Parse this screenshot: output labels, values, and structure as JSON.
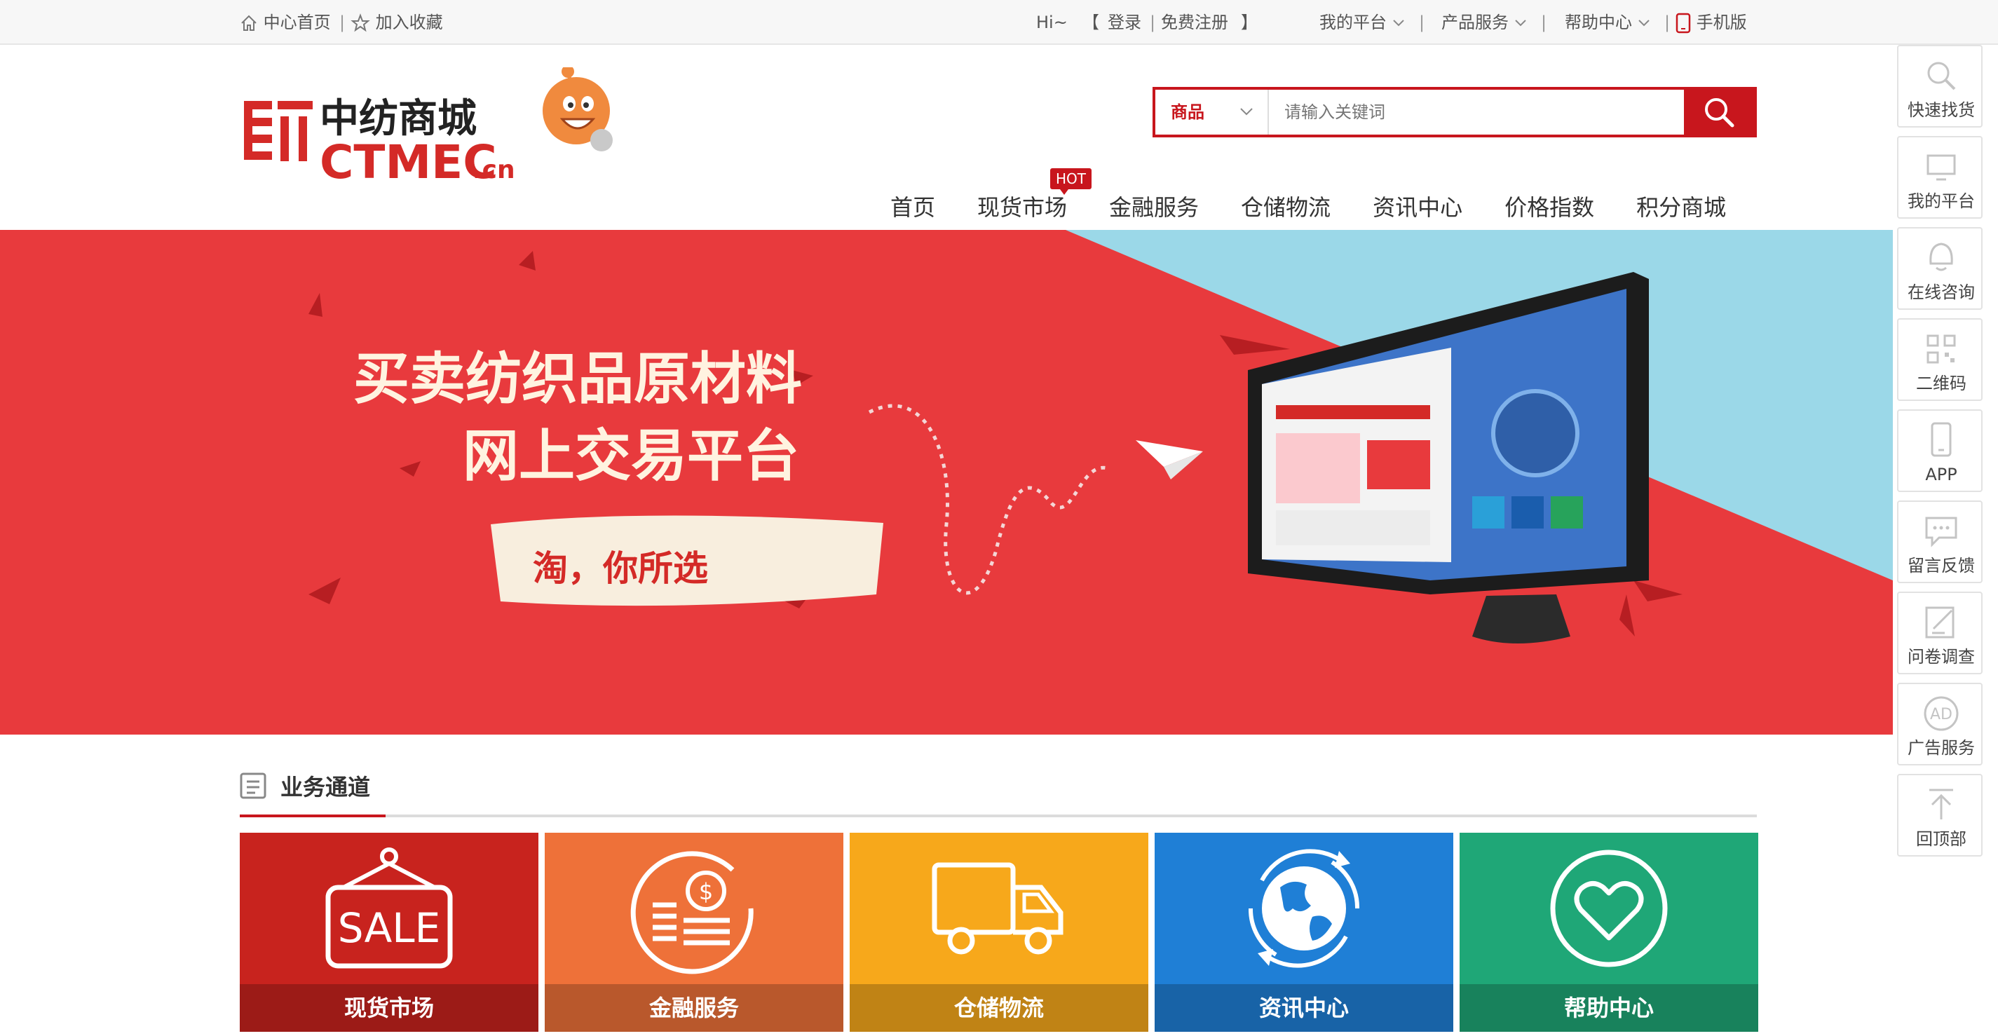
{
  "topbar": {
    "home_link": "中心首页",
    "favorite_link": "加入收藏",
    "greeting": "Hi~",
    "bracket_open": "【",
    "login": "登录",
    "register": "免费注册",
    "bracket_close": "】",
    "my_platform": "我的平台",
    "product_service": "产品服务",
    "help_center": "帮助中心",
    "mobile": "手机版"
  },
  "logo": {
    "name_cn": "中纺商城",
    "name_en": "CTMEC",
    "domain_suffix": ".cn"
  },
  "search": {
    "category": "商品",
    "placeholder": "请输入关键词",
    "value": ""
  },
  "nav": {
    "items": [
      "首页",
      "现货市场",
      "金融服务",
      "仓储物流",
      "资讯中心",
      "价格指数",
      "积分商城"
    ],
    "hot_badge": "HOT"
  },
  "banner": {
    "line1": "买卖纺织品原材料",
    "line2": "网上交易平台",
    "slogan": "淘，你所选",
    "slides": 2,
    "active_slide": 2,
    "colors": {
      "red": "#e83a3d",
      "blue": "#9bd8e8"
    }
  },
  "section": {
    "title": "业务通道"
  },
  "tiles": [
    {
      "label": "现货市场",
      "color": "#c8231e",
      "icon": "sale-sign-icon",
      "icon_text": "SALE"
    },
    {
      "label": "金融服务",
      "color": "#ee7139",
      "icon": "coins-icon",
      "icon_text": "$"
    },
    {
      "label": "仓储物流",
      "color": "#f7a81b",
      "icon": "truck-icon"
    },
    {
      "label": "资讯中心",
      "color": "#1f7fd6",
      "icon": "globe-icon"
    },
    {
      "label": "帮助中心",
      "color": "#1fa777",
      "icon": "heart-icon"
    }
  ],
  "sidebar": [
    {
      "label": "快速找货",
      "icon": "search-icon"
    },
    {
      "label": "我的平台",
      "icon": "monitor-icon"
    },
    {
      "label": "在线咨询",
      "icon": "chat-person-icon"
    },
    {
      "label": "二维码",
      "icon": "qr-code-icon"
    },
    {
      "label": "APP",
      "icon": "phone-icon"
    },
    {
      "label": "留言反馈",
      "icon": "message-icon"
    },
    {
      "label": "问卷调查",
      "icon": "survey-icon"
    },
    {
      "label": "广告服务",
      "icon": "ad-icon"
    },
    {
      "label": "回顶部",
      "icon": "back-to-top-icon"
    }
  ],
  "colors": {
    "brand_red": "#c8161d"
  }
}
